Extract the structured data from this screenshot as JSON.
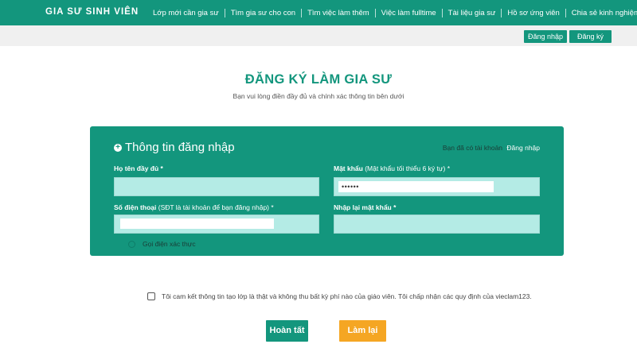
{
  "header": {
    "brand": "GIA SƯ SINH VIÊN",
    "nav": [
      {
        "label": "Lớp mới cần gia sư"
      },
      {
        "label": "Tìm gia sư cho con"
      },
      {
        "label": "Tìm việc làm thêm"
      },
      {
        "label": "Việc làm fulltime"
      },
      {
        "label": "Tài liệu gia sư"
      },
      {
        "label": "Hồ sơ ứng viên"
      },
      {
        "label": "Chia sẻ kinh nghiệm"
      }
    ],
    "login_label": "Đăng nhập",
    "register_label": "Đăng ký"
  },
  "page": {
    "title": "ĐĂNG KÝ LÀM GIA SƯ",
    "subtitle": "Bạn vui lòng điền đầy đủ và chính xác thông tin bên dưới"
  },
  "form": {
    "section_title": "Thông tin đăng nhập",
    "have_account_text": "Bạn đã có tài khoản",
    "have_account_link": "Đăng nhập",
    "fullname": {
      "label": "Họ tên đầy đủ *",
      "value": ""
    },
    "password": {
      "label": "Mật khẩu",
      "hint": "(Mật khẩu tối thiểu 6 ký tự) *",
      "value": "••••••"
    },
    "phone": {
      "label": "Số điện thoại",
      "hint": "(SĐT là tài khoản để bạn đăng nhập) *",
      "value": ""
    },
    "repassword": {
      "label": "Nhập lại mật khẩu *",
      "value": ""
    },
    "call_verify_label": "Gọi điện xác thực"
  },
  "commitment": {
    "text": "Tôi cam kết thông tin tạo lớp là thật và không thu bất kỳ phí nào của giáo viên. Tôi chấp nhận các quy định của vieclam123.",
    "checked": false
  },
  "actions": {
    "submit_label": "Hoàn tất",
    "reset_label": "Làm lại"
  },
  "colors": {
    "primary": "#13967d",
    "input_bg": "#b4ebe5",
    "reset_button": "#f5a623"
  }
}
